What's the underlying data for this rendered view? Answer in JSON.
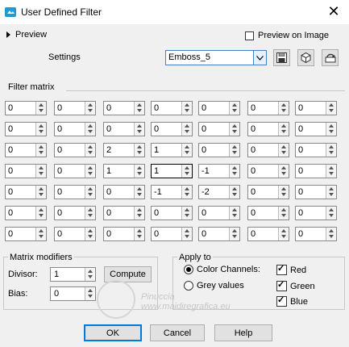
{
  "window": {
    "title": "User Defined Filter"
  },
  "preview": {
    "label": "Preview",
    "on_image_label": "Preview on Image",
    "on_image_checked": false
  },
  "settings": {
    "label": "Settings",
    "value": "Emboss_5"
  },
  "filter_matrix": {
    "label": "Filter matrix",
    "values": [
      [
        "0",
        "0",
        "0",
        "0",
        "0",
        "0",
        "0"
      ],
      [
        "0",
        "0",
        "0",
        "0",
        "0",
        "0",
        "0"
      ],
      [
        "0",
        "0",
        "2",
        "1",
        "0",
        "0",
        "0"
      ],
      [
        "0",
        "0",
        "1",
        "1",
        "-1",
        "0",
        "0"
      ],
      [
        "0",
        "0",
        "0",
        "-1",
        "-2",
        "0",
        "0"
      ],
      [
        "0",
        "0",
        "0",
        "0",
        "0",
        "0",
        "0"
      ],
      [
        "0",
        "0",
        "0",
        "0",
        "0",
        "0",
        "0"
      ]
    ]
  },
  "modifiers": {
    "label": "Matrix modifiers",
    "divisor_label": "Divisor:",
    "divisor_value": "1",
    "bias_label": "Bias:",
    "bias_value": "0",
    "compute_label": "Compute"
  },
  "apply_to": {
    "label": "Apply to",
    "color_channels_label": "Color Channels:",
    "grey_values_label": "Grey values",
    "selected": "color_channels",
    "red_label": "Red",
    "green_label": "Green",
    "blue_label": "Blue",
    "red": true,
    "green": true,
    "blue": true
  },
  "buttons": {
    "ok": "OK",
    "cancel": "Cancel",
    "help": "Help"
  },
  "watermark": {
    "name": "Pinuccia",
    "site": "www.maidiregrafica.eu"
  }
}
